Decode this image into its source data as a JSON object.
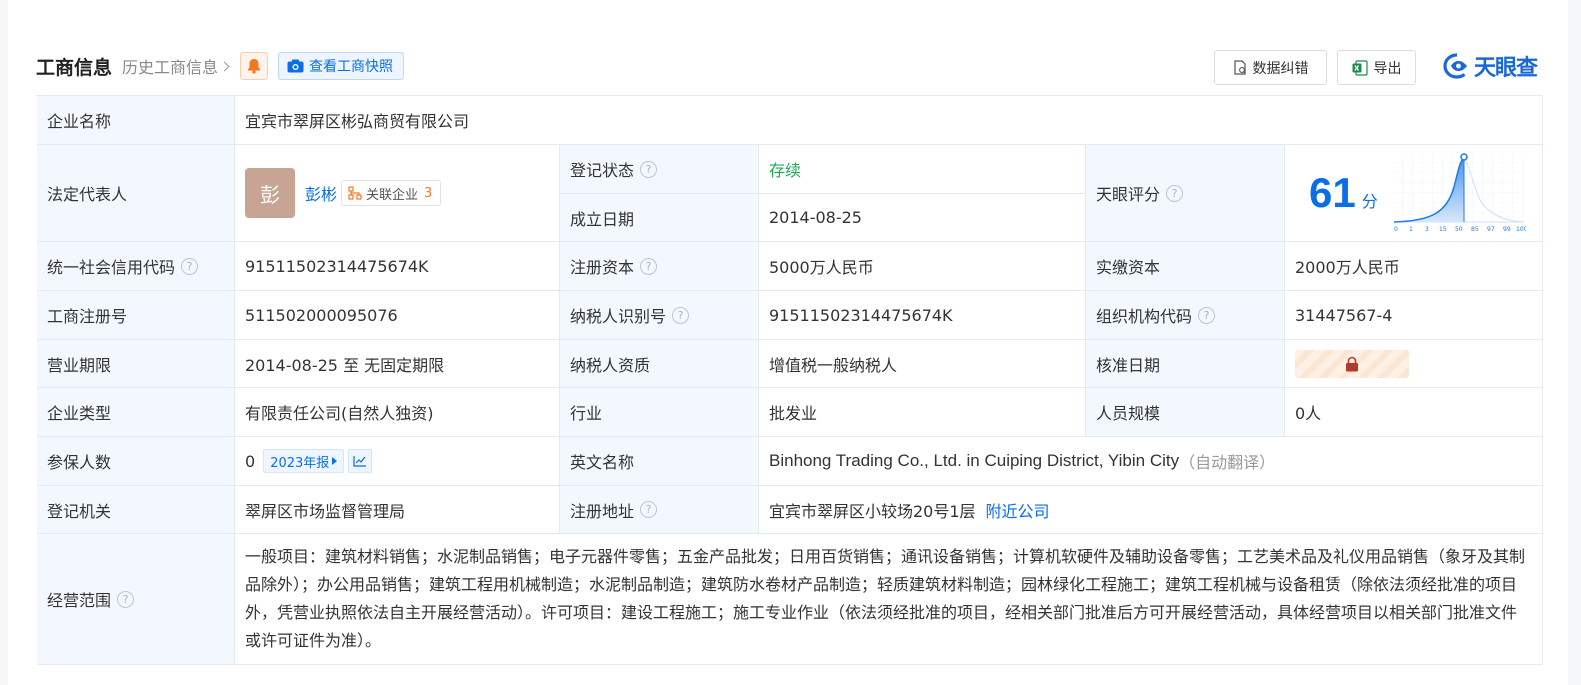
{
  "header": {
    "title": "工商信息",
    "history_link": "历史工商信息",
    "snapshot_button": "查看工商快照",
    "correction_button": "数据纠错",
    "export_button": "导出",
    "logo_text": "天眼查"
  },
  "rows": {
    "company_name": {
      "label": "企业名称",
      "value": "宜宾市翠屏区彬弘商贸有限公司"
    },
    "legal_rep": {
      "label": "法定代表人",
      "avatar_char": "彭",
      "name": "彭彬",
      "related_label": "关联企业",
      "related_count": "3"
    },
    "reg_status": {
      "label": "登记状态",
      "value": "存续"
    },
    "established": {
      "label": "成立日期",
      "value": "2014-08-25"
    },
    "tianyan_score": {
      "label": "天眼评分",
      "score": "61",
      "unit": "分",
      "axis_ticks": [
        "0",
        "1",
        "3",
        "15",
        "50",
        "85",
        "97",
        "99",
        "100"
      ]
    },
    "credit_code": {
      "label": "统一社会信用代码",
      "value": "91511502314475674K"
    },
    "reg_capital": {
      "label": "注册资本",
      "value": "5000万人民币"
    },
    "paid_capital": {
      "label": "实缴资本",
      "value": "2000万人民币"
    },
    "reg_number": {
      "label": "工商注册号",
      "value": "511502000095076"
    },
    "taxpayer_id": {
      "label": "纳税人识别号",
      "value": "91511502314475674K"
    },
    "org_code": {
      "label": "组织机构代码",
      "value": "31447567-4"
    },
    "business_term": {
      "label": "营业期限",
      "value": "2014-08-25 至 无固定期限"
    },
    "taxpayer_qual": {
      "label": "纳税人资质",
      "value": "增值税一般纳税人"
    },
    "approval_date": {
      "label": "核准日期"
    },
    "company_type": {
      "label": "企业类型",
      "value": "有限责任公司(自然人独资)"
    },
    "industry": {
      "label": "行业",
      "value": "批发业"
    },
    "staff_size": {
      "label": "人员规模",
      "value": "0人"
    },
    "insured": {
      "label": "参保人数",
      "value": "0",
      "year_tag": "2023年报"
    },
    "english_name": {
      "label": "英文名称",
      "value": "Binhong Trading Co., Ltd. in Cuiping District, Yibin City",
      "note": "（自动翻译）"
    },
    "reg_authority": {
      "label": "登记机关",
      "value": "翠屏区市场监督管理局"
    },
    "reg_address": {
      "label": "注册地址",
      "value": "宜宾市翠屏区小较场20号1层",
      "link": "附近公司"
    },
    "business_scope": {
      "label": "经营范围",
      "value": "一般项目：建筑材料销售；水泥制品销售；电子元器件零售；五金产品批发；日用百货销售；通讯设备销售；计算机软硬件及辅助设备零售；工艺美术品及礼仪用品销售（象牙及其制品除外）；办公用品销售；建筑工程用机械制造；水泥制品制造；建筑防水卷材产品制造；轻质建筑材料制造；园林绿化工程施工；建筑工程机械与设备租赁（除依法须经批准的项目外，凭营业执照依法自主开展经营活动）。许可项目：建设工程施工；施工专业作业（依法须经批准的项目，经相关部门批准后方可开展经营活动，具体经营项目以相关部门批准文件或许可证件为准）。"
    }
  },
  "colors": {
    "accent": "#0a6ee8",
    "status_green": "#1aaa55",
    "label_bg": "#f3f8fe",
    "border": "#e4eaf2"
  }
}
